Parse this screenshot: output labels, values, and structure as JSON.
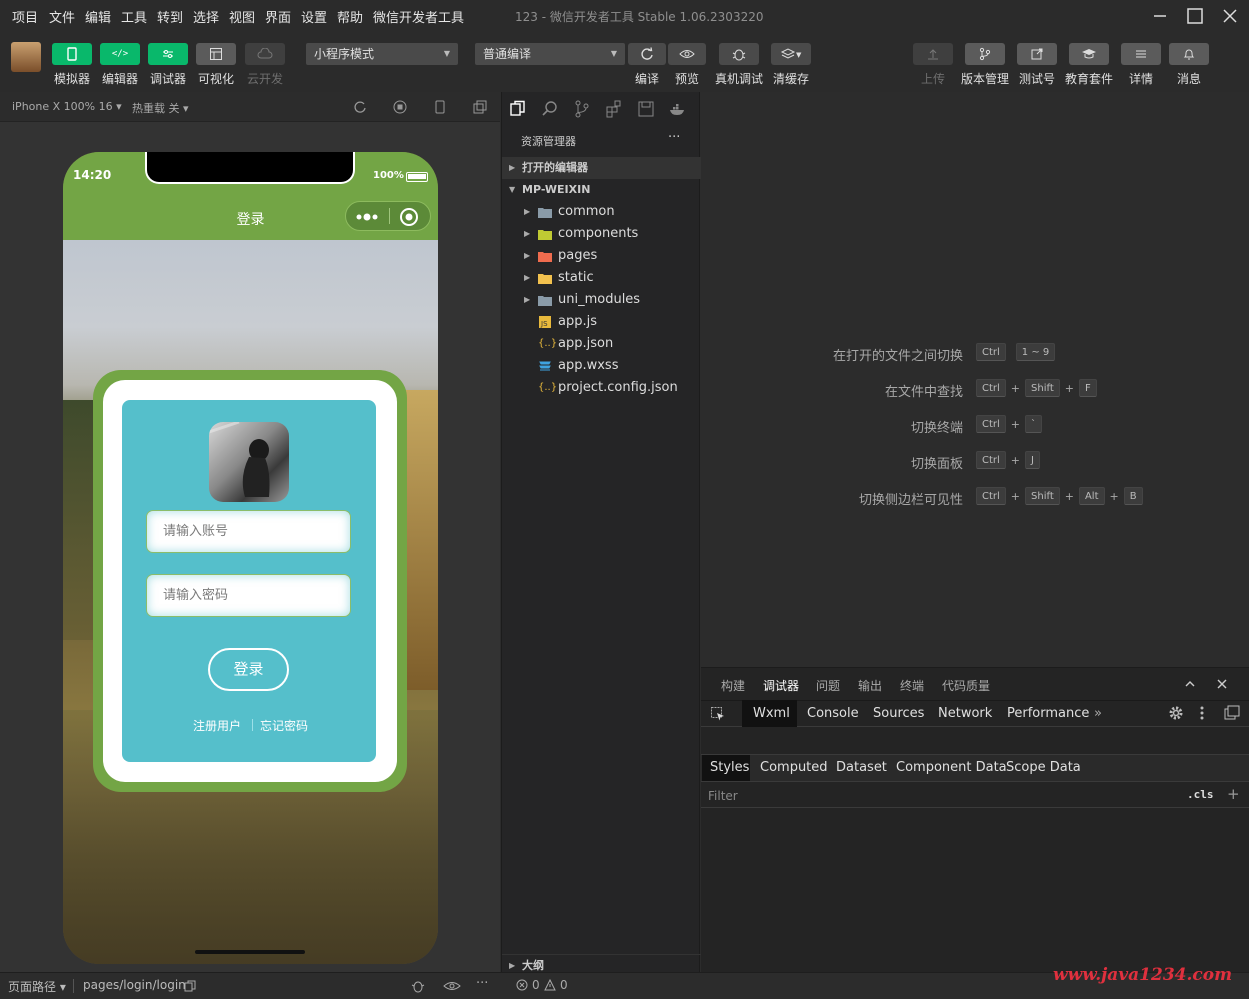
{
  "menu": [
    "项目",
    "文件",
    "编辑",
    "工具",
    "转到",
    "选择",
    "视图",
    "界面",
    "设置",
    "帮助",
    "微信开发者工具"
  ],
  "window_title": "123 - 微信开发者工具 Stable 1.06.2303220",
  "toolbar": {
    "left": [
      "模拟器",
      "编辑器",
      "调试器",
      "可视化",
      "云开发"
    ],
    "mode_select": "小程序模式",
    "compile_select": "普通编译",
    "mid": [
      "编译",
      "预览",
      "真机调试",
      "清缓存"
    ],
    "right": [
      "上传",
      "版本管理",
      "测试号",
      "教育套件",
      "详情",
      "消息"
    ]
  },
  "simhead": {
    "device": "iPhone X 100% 16",
    "hotreload": "热重载 关"
  },
  "phone": {
    "time": "14:20",
    "battery": "100%",
    "nav_title": "登录",
    "account_placeholder": "请输入账号",
    "password_placeholder": "请输入密码",
    "login_button": "登录",
    "register_link": "注册用户",
    "forgot_link": "忘记密码"
  },
  "explorer": {
    "title": "资源管理器",
    "more": "···",
    "open_editors": "打开的编辑器",
    "project": "MP-WEIXIN",
    "folders": [
      "common",
      "components",
      "pages",
      "static",
      "uni_modules"
    ],
    "files": [
      "app.js",
      "app.json",
      "app.wxss",
      "project.config.json"
    ],
    "outline": "大纲"
  },
  "welcome": [
    {
      "desc": "在打开的文件之间切换",
      "keys": [
        "Ctrl",
        "1 ~ 9"
      ]
    },
    {
      "desc": "在文件中查找",
      "keys": [
        "Ctrl",
        "Shift",
        "F"
      ]
    },
    {
      "desc": "切换终端",
      "keys": [
        "Ctrl",
        "`"
      ]
    },
    {
      "desc": "切换面板",
      "keys": [
        "Ctrl",
        "J"
      ]
    },
    {
      "desc": "切换侧边栏可见性",
      "keys": [
        "Ctrl",
        "Shift",
        "Alt",
        "B"
      ]
    }
  ],
  "devtools": {
    "tabs": [
      "构建",
      "调试器",
      "问题",
      "输出",
      "终端",
      "代码质量"
    ],
    "chrome_tabs": [
      "Wxml",
      "Console",
      "Sources",
      "Network",
      "Performance"
    ],
    "style_tabs": [
      "Styles",
      "Computed",
      "Dataset",
      "Component Data",
      "Scope Data"
    ],
    "filter_placeholder": "Filter",
    "cls": ".cls"
  },
  "status": {
    "path_label": "页面路径",
    "path": "pages/login/login",
    "problems": "0",
    "warnings": "0"
  },
  "watermark": "www.java1234.com"
}
